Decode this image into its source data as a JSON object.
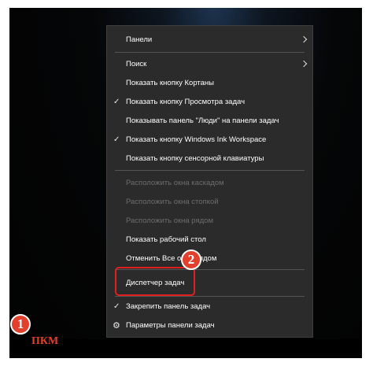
{
  "menu": {
    "items": [
      {
        "label": "Панели",
        "submenu": true
      },
      {
        "label": "Поиск",
        "submenu": true
      },
      {
        "label": "Показать кнопку Кортаны"
      },
      {
        "label": "Показать кнопку Просмотра задач",
        "checked": true
      },
      {
        "label": "Показывать панель \"Люди\" на панели задач"
      },
      {
        "label": "Показать кнопку Windows Ink Workspace",
        "checked": true
      },
      {
        "label": "Показать кнопку сенсорной клавиатуры"
      },
      {
        "label": "Расположить окна каскадом",
        "disabled": true
      },
      {
        "label": "Расположить окна стопкой",
        "disabled": true
      },
      {
        "label": "Расположить окна рядом",
        "disabled": true
      },
      {
        "label": "Показать рабочий стол"
      },
      {
        "label": "Отменить Все окна рядом"
      },
      {
        "label": "Диспетчер задач"
      },
      {
        "label": "Закрепить панель задач",
        "checked": true
      },
      {
        "label": "Параметры панели задач",
        "icon": "gear-icon"
      }
    ]
  },
  "annotations": {
    "badge_1": "1",
    "badge_2": "2",
    "click_label": "ПКМ"
  },
  "icons": {
    "check": "✓",
    "gear": "⚙"
  },
  "colors": {
    "menu_bg": "#2b2b2b",
    "highlight": "#e01e1e",
    "badge": "#e2402d"
  }
}
